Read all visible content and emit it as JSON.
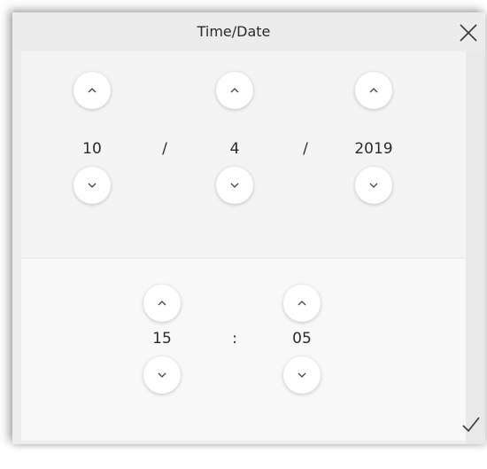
{
  "dialog": {
    "title": "Time/Date",
    "close_icon": "close-icon",
    "confirm_icon": "checkmark-icon"
  },
  "date": {
    "day": "10",
    "month": "4",
    "year": "2019",
    "separator_1": "/",
    "separator_2": "/"
  },
  "time": {
    "hour": "15",
    "minute": "05",
    "separator": ":"
  },
  "icons": {
    "increment": "chevron-up-icon",
    "decrement": "chevron-down-icon"
  }
}
